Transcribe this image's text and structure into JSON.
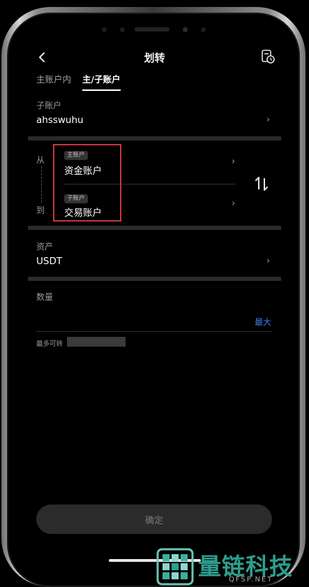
{
  "header": {
    "title": "划转"
  },
  "tabs": [
    {
      "label": "主账户内",
      "active": false
    },
    {
      "label": "主/子账户",
      "active": true
    }
  ],
  "subaccount": {
    "label": "子账户",
    "value": "ahsswuhu"
  },
  "transfer": {
    "from_label": "从",
    "to_label": "到",
    "from_badge": "主账户",
    "from_account": "资金账户",
    "to_badge": "子账户",
    "to_account": "交易账户"
  },
  "asset": {
    "label": "资产",
    "value": "USDT"
  },
  "amount": {
    "label": "数量",
    "max_label": "最大",
    "available_label": "最多可转"
  },
  "confirm_label": "确定",
  "watermark": {
    "text": "量链科技",
    "sub": "QFSP.NET"
  },
  "colors": {
    "highlight_box": "#c8363d",
    "max_link": "#3d7eea",
    "watermark": "#2e9e8f"
  },
  "icons": {
    "back": "chevron-left-icon",
    "history": "history-record-icon",
    "swap": "swap-arrows-icon"
  }
}
